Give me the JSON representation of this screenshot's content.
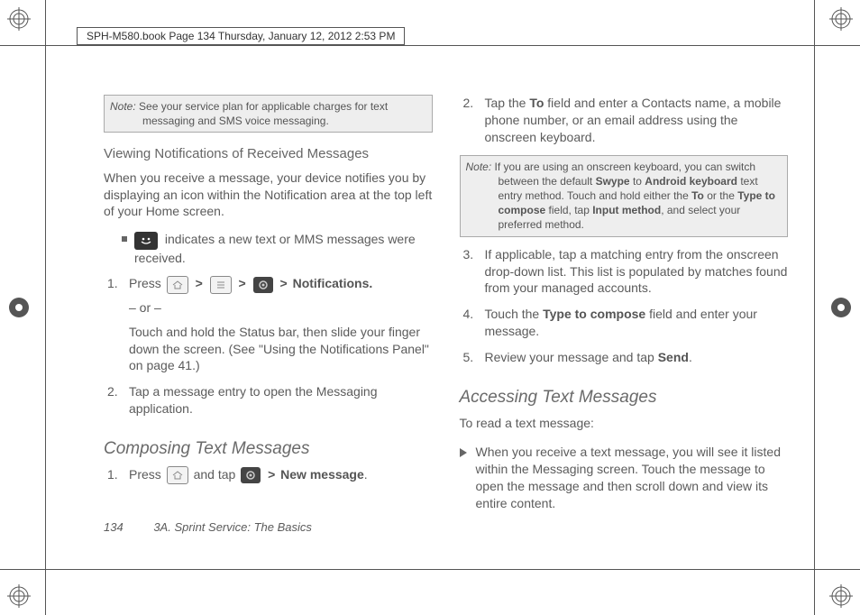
{
  "header": {
    "text": "SPH-M580.book  Page 134  Thursday, January 12, 2012  2:53 PM"
  },
  "left": {
    "note1_label": "Note:",
    "note1_text": "See your service plan for applicable charges for text messaging and SMS voice messaging.",
    "sub1": "Viewing Notifications of Received Messages",
    "para1": "When you receive a message, your device notifies you by displaying an icon within the Notification area at the top left of your Home screen.",
    "bullet1": " indicates a new text or MMS messages were received.",
    "step1_a": "Press ",
    "step1_end": "Notifications.",
    "or": "– or –",
    "step1_alt": "Touch and hold the Status bar, then slide your finger down the screen. (See \"Using the Notifications Panel\" on page 41.)",
    "step2": "Tap a message entry to open the Messaging application.",
    "head2": "Composing Text Messages",
    "compose1_a": "Press ",
    "compose1_b": " and tap ",
    "compose1_end": "New message",
    "period": "."
  },
  "right": {
    "step2_a": "Tap the ",
    "step2_b": "To",
    "step2_c": " field and enter a Contacts name, a mobile phone number, or an email address using the onscreen keyboard.",
    "note2_label": "Note:",
    "note2_text_a": "If you are using an onscreen keyboard, you can switch between the default ",
    "note2_b1": "Swype",
    "note2_mid1": " to ",
    "note2_b2": "Android keyboard",
    "note2_mid2": " text entry method. Touch and hold either the ",
    "note2_b3": "To",
    "note2_mid3": " or the ",
    "note2_b4": "Type to compose",
    "note2_mid4": " field, tap ",
    "note2_b5": "Input method",
    "note2_end": ", and select your preferred method.",
    "step3": "If applicable, tap a matching entry from the onscreen drop-down list. This list is populated by matches found from your managed accounts.",
    "step4_a": "Touch the ",
    "step4_b": "Type to compose",
    "step4_c": " field and enter your message.",
    "step5_a": "Review your message and tap ",
    "step5_b": "Send",
    "step5_c": ".",
    "head3": "Accessing Text Messages",
    "read_label": "To read a text message:",
    "arrow_text": "When you receive a text message, you will see it listed within the Messaging screen. Touch the message to open the message and then scroll down and view its entire content."
  },
  "footer": {
    "page_num": "134",
    "chapter": "3A. Sprint Service: The Basics"
  }
}
